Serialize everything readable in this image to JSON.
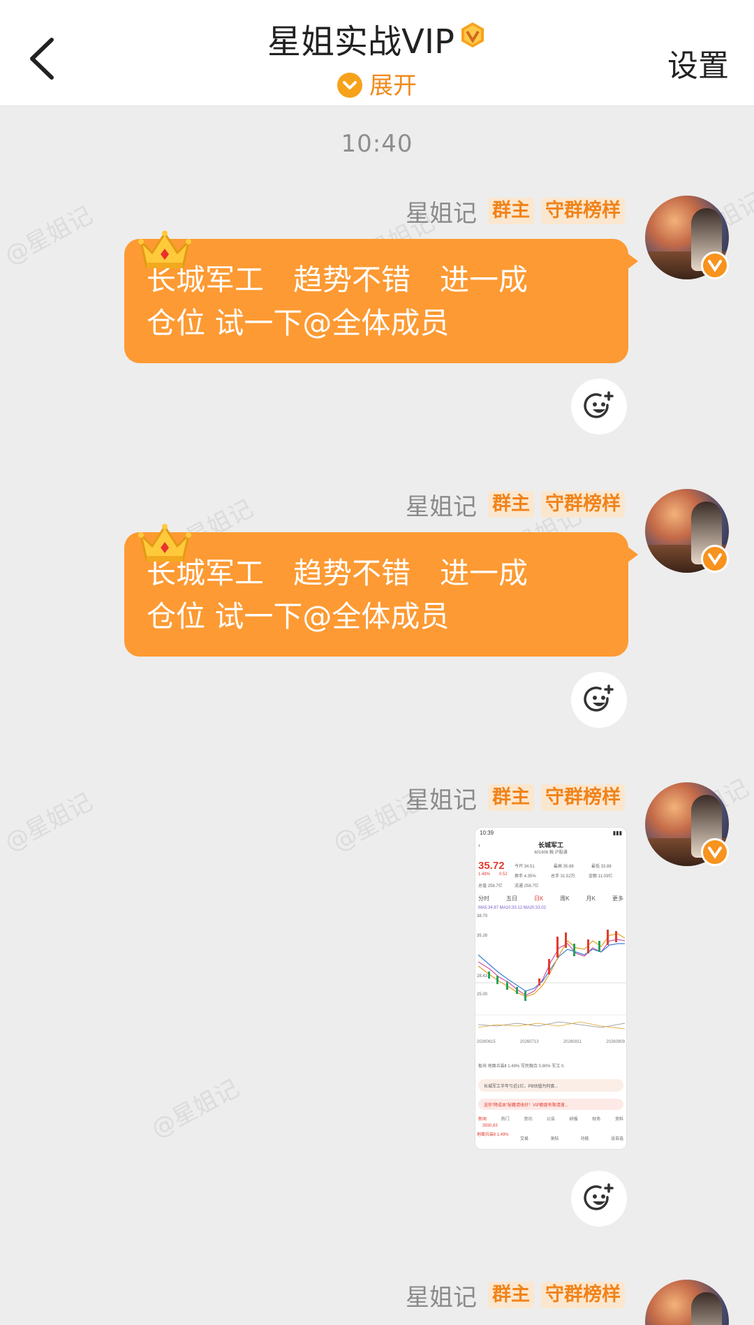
{
  "header": {
    "title": "星姐实战VIP",
    "expand_label": "展开",
    "settings_label": "设置"
  },
  "time_label": "10:40",
  "watermark": "@星姐记",
  "messages": [
    {
      "sender": "星姐记",
      "tags": [
        "群主",
        "守群榜样"
      ],
      "text_line1": "长城军工　趋势不错　进一成",
      "text_line2": "仓位  试一下@全体成员"
    },
    {
      "sender": "星姐记",
      "tags": [
        "群主",
        "守群榜样"
      ],
      "text_line1": "长城军工　趋势不错　进一成",
      "text_line2": "仓位  试一下@全体成员"
    },
    {
      "sender": "星姐记",
      "tags": [
        "群主",
        "守群榜样"
      ],
      "image": {
        "status_time": "10:39",
        "stock_name": "长城军工",
        "stock_code": "601606 融 沪股通",
        "price": "35.72",
        "change_pct": "1.48%",
        "change_amt": "0.52",
        "open": "今开 34.51",
        "high": "最高 35.88",
        "low": "最低 33.88",
        "turnover_rate": "换手 4.35%",
        "volume": "总手 31.52万",
        "amount": "金额 11.03亿",
        "market_cap": "总值 258.7亿",
        "float_cap": "流通 258.7亿",
        "tabs": [
          "分时",
          "五日",
          "日K",
          "周K",
          "月K",
          "更多"
        ],
        "ma_label": "MA5:34.87 MA10:33.12 MA20:33.02",
        "y_ticks": [
          "38.70",
          "35.28",
          "28.43",
          "25.00"
        ],
        "dates": [
          "20260615",
          "20260713",
          "20260811",
          "20260909"
        ],
        "sector_line": "板块  地面兵装Ⅱ 1.49%   军民融合 0.80%   军工 0.",
        "news_line": "长城军工半年亏近1亿，PB估值为何袁...",
        "promo_line": "送你“降成本”秘籍请收好！VIP额度有限请速...",
        "bottom_tabs": [
          "新闻",
          "热门",
          "资讯",
          "公告",
          "研报",
          "财务",
          "资料"
        ],
        "bottom_value": "3930.83",
        "bottom_sector": "地面兵装Ⅱ 1.49%",
        "bottom_actions": [
          "交易",
          "发帖",
          "功能",
          "设自选"
        ]
      }
    },
    {
      "sender": "星姐记",
      "tags": [
        "群主",
        "守群榜样"
      ]
    }
  ],
  "colors": {
    "bubble": "#fd9a33",
    "tag_bg": "#fbe7cf",
    "tag_text": "#f0831a",
    "background": "#ededed",
    "accent": "#f7a21b"
  }
}
